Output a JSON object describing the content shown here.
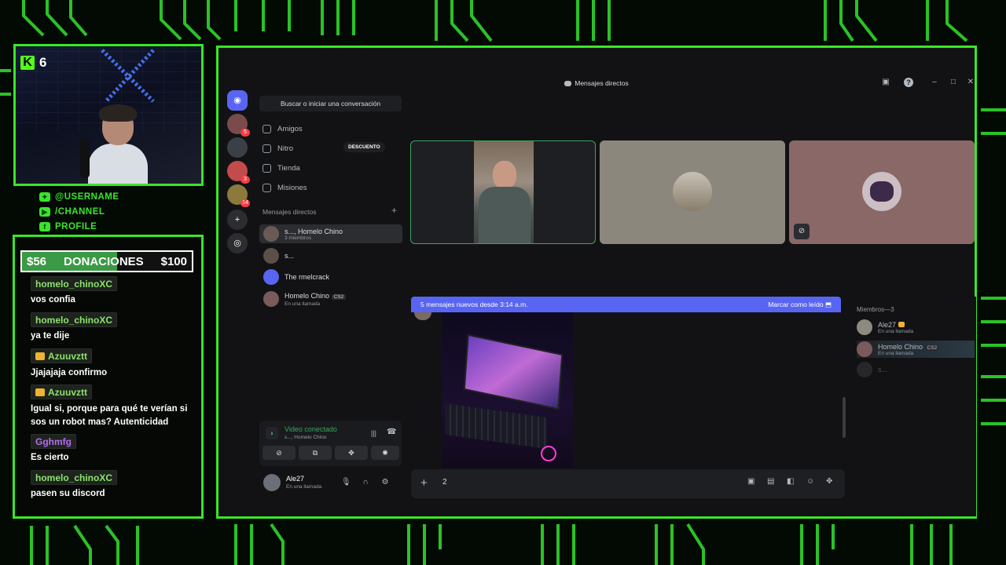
{
  "stream": {
    "viewer_count": "6",
    "kick_logo": "K",
    "socials": [
      {
        "icon": "twitter-icon",
        "label": "@USERNAME"
      },
      {
        "icon": "youtube-icon",
        "label": "/CHANNEL"
      },
      {
        "icon": "facebook-icon",
        "label": "PROFILE"
      }
    ],
    "donations": {
      "current": "$56",
      "label": "DONACIONES",
      "goal": "$100",
      "progress": 0.56
    },
    "chat": [
      {
        "user": "homelo_chinoXC",
        "color": "#8be36b",
        "crown": false,
        "text": "vos confia"
      },
      {
        "user": "homelo_chinoXC",
        "color": "#8be36b",
        "crown": false,
        "text": "ya te dije"
      },
      {
        "user": "Azuuvztt",
        "color": "#8be36b",
        "crown": true,
        "text": "Jjajajaja confirmo"
      },
      {
        "user": "Azuuvztt",
        "color": "#8be36b",
        "crown": true,
        "text": "Igual si, porque para qué te verían si sos un robot mas? Autenticidad"
      },
      {
        "user": "Gghmfg",
        "color": "#b56cf2",
        "crown": false,
        "text": "Es cierto"
      },
      {
        "user": "homelo_chinoXC",
        "color": "#8be36b",
        "crown": false,
        "text": "pasen su discord"
      }
    ]
  },
  "discord": {
    "title": "Mensajes directos",
    "search_placeholder": "Buscar o iniciar una conversación",
    "nav": [
      {
        "icon": "friends-icon",
        "label": "Amigos"
      },
      {
        "icon": "nitro-icon",
        "label": "Nitro"
      },
      {
        "icon": "shop-icon",
        "label": "Tienda"
      },
      {
        "icon": "quests-icon",
        "label": "Misiones"
      }
    ],
    "nitro_badge": "DESCUENTO",
    "dm_header": "Mensajes directos",
    "dms": [
      {
        "name": "s..., Homelo Chino",
        "sub": "3 miembros",
        "active": true
      },
      {
        "name": "s...",
        "sub": "",
        "active": false
      },
      {
        "name": "The rmelcrack",
        "sub": "",
        "active": false
      },
      {
        "name": "Homelo Chino",
        "tag": "CS2",
        "sub": "En una llamada",
        "active": false
      }
    ],
    "guild_badges": [
      "5",
      "3",
      "14"
    ],
    "voice": {
      "status": "Video conectado",
      "channel": "s..., Homelo Chino"
    },
    "user": {
      "name": "Ale27",
      "status": "En una llamada"
    },
    "new_messages": "5 mensajes nuevos desde 3:14 a.m.",
    "mark_read": "Marcar como leído",
    "input_value": "2",
    "members_header": "Miembros—3",
    "members": [
      {
        "name": "Ale27",
        "status": "En una llamada",
        "crown": true
      },
      {
        "name": "Homelo Chino",
        "tag": "CS2",
        "status": "En una llamada",
        "crown": false
      },
      {
        "name": "s...",
        "status": "",
        "crown": false
      }
    ]
  },
  "colors": {
    "accent": "#39e629",
    "discord_blurple": "#5865f2",
    "voice_green": "#3ba55d"
  }
}
